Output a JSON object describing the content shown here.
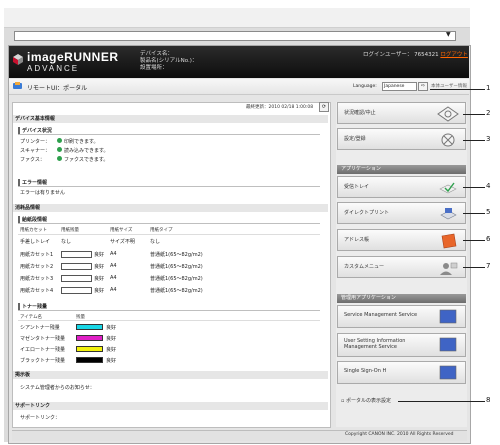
{
  "browser": {
    "address_bar": ""
  },
  "header": {
    "brand_line1": "imageRUNNER",
    "brand_line2": "ADVANCE",
    "device_name_label": "デバイス名：",
    "serial_label": "製品名(シリアルNo.)：",
    "location_label": "設置場所：",
    "login_user_label": "ログインユーザー：",
    "login_user": "7654321",
    "logout": "ログアウト"
  },
  "titlebar": {
    "page_title": "リモートUI：ポータル",
    "language_label": "Language:",
    "language_value": "Japanese",
    "extra_link": "本体ユーザー情報"
  },
  "main": {
    "last_updated": "最終更新：2010 02/18 1:00:08",
    "device_basic_info": "デバイス基本情報",
    "device_status": {
      "title": "デバイス状況",
      "rows": [
        {
          "label": "プリンター：",
          "status": "印刷できます。"
        },
        {
          "label": "スキャナー：",
          "status": "読み込みできます。"
        },
        {
          "label": "ファクス：",
          "status": "ファクスできます。"
        }
      ]
    },
    "error_info": {
      "title": "エラー情報",
      "text": "エラーは有りません"
    },
    "consumables": "消耗品情報",
    "paper_info": {
      "title": "給紙段情報",
      "headers": [
        "用紙カセット",
        "用紙残量",
        "用紙サイズ",
        "用紙タイプ"
      ],
      "rows": [
        {
          "source": "手差しトレイ",
          "remain": "なし",
          "size": "サイズ不明",
          "type": "なし",
          "box": false
        },
        {
          "source": "用紙カセット1",
          "remain": "良好",
          "size": "A4",
          "type": "普通紙1(65～82g/m2)",
          "box": true
        },
        {
          "source": "用紙カセット2",
          "remain": "良好",
          "size": "A4",
          "type": "普通紙1(65～82g/m2)",
          "box": true
        },
        {
          "source": "用紙カセット3",
          "remain": "良好",
          "size": "A4",
          "type": "普通紙1(65～82g/m2)",
          "box": true
        },
        {
          "source": "用紙カセット4",
          "remain": "良好",
          "size": "A4",
          "type": "普通紙1(65～82g/m2)",
          "box": true
        }
      ]
    },
    "toner": {
      "title": "トナー残量",
      "headers": [
        "アイテム名",
        "残量"
      ],
      "rows": [
        {
          "name": "シアントナー残量",
          "level": "良好",
          "color": "#19d7e6"
        },
        {
          "name": "マゼンタトナー残量",
          "level": "良好",
          "color": "#e020c6"
        },
        {
          "name": "イエロートナー残量",
          "level": "良好",
          "color": "#f2f20e"
        },
        {
          "name": "ブラックトナー残量",
          "level": "良好",
          "color": "#000000"
        }
      ]
    },
    "message_board": {
      "title": "掲示板",
      "text": "システム管理者からのお知らせ："
    },
    "support": {
      "title": "サポートリンク",
      "text": "サポートリンク："
    }
  },
  "sidebar": {
    "top_buttons": [
      {
        "label": "状況確認/中止",
        "icon": "status-monitor-icon"
      },
      {
        "label": "設定/登録",
        "icon": "settings-gear-icon"
      }
    ],
    "apps_heading": "アプリケーション",
    "apps": [
      {
        "label": "受信トレイ",
        "icon": "inbox-tray-icon"
      },
      {
        "label": "ダイレクトプリント",
        "icon": "direct-print-icon"
      },
      {
        "label": "アドレス帳",
        "icon": "address-book-icon"
      },
      {
        "label": "カスタムメニュー",
        "icon": "custom-menu-icon"
      }
    ],
    "mgmt_heading": "管理用アプリケーション",
    "mgmt": [
      {
        "label": "Service Management Service"
      },
      {
        "label": "User Setting Information Management Service"
      },
      {
        "label": "Single Sign-On H"
      }
    ],
    "portal_link": "ポータルの表示設定"
  },
  "footer": {
    "copyright": "Copyright CANON INC. 2010 All Rights Reserved"
  },
  "callouts": [
    "1",
    "2",
    "3",
    "4",
    "5",
    "6",
    "7",
    "8"
  ]
}
